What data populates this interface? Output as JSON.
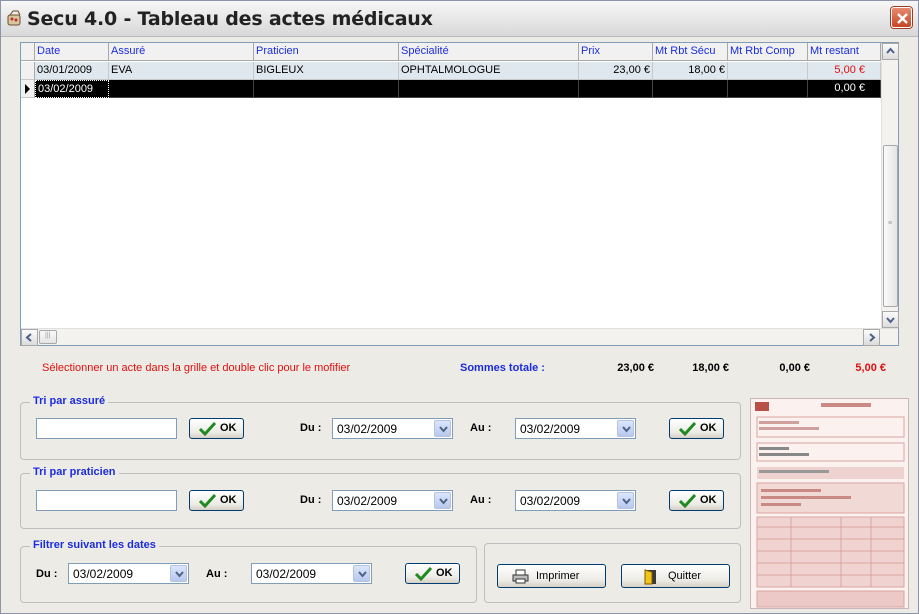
{
  "window": {
    "title": "Secu 4.0 - Tableau des actes médicaux",
    "close_icon": "close-icon",
    "app_icon": "app-icon"
  },
  "grid": {
    "columns": [
      "Date",
      "Assuré",
      "Praticien",
      "Spécialité",
      "Prix",
      "Mt Rbt Sécu",
      "Mt Rbt Comp",
      "Mt restant"
    ],
    "rows": [
      {
        "date": "03/01/2009",
        "assure": "EVA",
        "praticien": "BIGLEUX",
        "specialite": "OPHTALMOLOGUE",
        "prix": "23,00 €",
        "rbt_secu": "18,00 €",
        "rbt_comp": "",
        "restant": "5,00 €"
      },
      {
        "date": "03/02/2009",
        "assure": "",
        "praticien": "",
        "specialite": "",
        "prix": "",
        "rbt_secu": "",
        "rbt_comp": "",
        "restant": "0,00 €"
      }
    ]
  },
  "status": {
    "hint": "Sélectionner un acte dans la grille et double clic pour le mofifier",
    "sum_label": "Sommes totale :",
    "sum_prix": "23,00 €",
    "sum_secu": "18,00 €",
    "sum_comp": "0,00 €",
    "sum_restant": "5,00 €"
  },
  "tri_assure": {
    "title": "Tri par assuré",
    "input_value": "",
    "ok": "OK",
    "du_label": "Du :",
    "du_value": "03/02/2009",
    "au_label": "Au :",
    "au_value": "03/02/2009",
    "ok2": "OK"
  },
  "tri_praticien": {
    "title": "Tri par praticien",
    "input_value": "",
    "ok": "OK",
    "du_label": "Du :",
    "du_value": "03/02/2009",
    "au_label": "Au :",
    "au_value": "03/02/2009",
    "ok2": "OK"
  },
  "filtre_dates": {
    "title": "Filtrer suivant les dates",
    "du_label": "Du :",
    "du_value": "03/02/2009",
    "au_label": "Au :",
    "au_value": "03/02/2009",
    "ok": "OK"
  },
  "actions": {
    "imprimer": "Imprimer",
    "quitter": "Quitter"
  },
  "colors": {
    "header_text": "#1c2ce0",
    "alert": "#e01010",
    "selected_row": "#000000",
    "row_highlight": "#dfe8ee"
  }
}
